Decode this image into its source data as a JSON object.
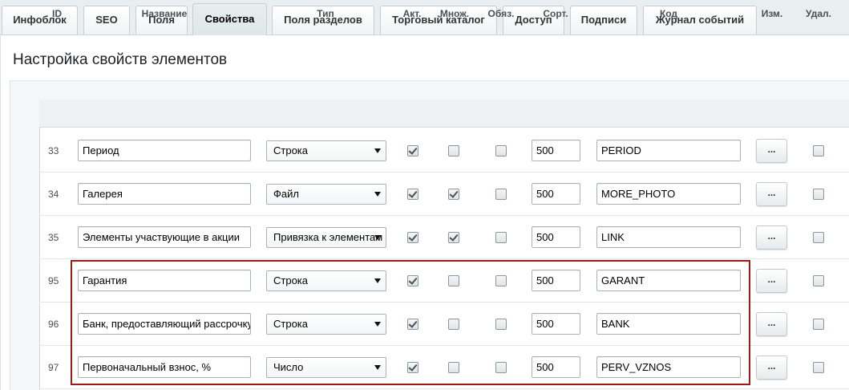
{
  "tabs": [
    {
      "label": "Инфоблок",
      "active": false
    },
    {
      "label": "SEO",
      "active": false
    },
    {
      "label": "Поля",
      "active": false
    },
    {
      "label": "Свойства",
      "active": true
    },
    {
      "label": "Поля разделов",
      "active": false
    },
    {
      "label": "Торговый каталог",
      "active": false
    },
    {
      "label": "Доступ",
      "active": false
    },
    {
      "label": "Подписи",
      "active": false
    },
    {
      "label": "Журнал событий",
      "active": false
    }
  ],
  "page_title": "Настройка свойств элементов",
  "columns": {
    "id": "ID",
    "name": "Название",
    "type": "Тип",
    "active": "Акт.",
    "multiple": "Множ.",
    "required": "Обяз.",
    "sort": "Сорт.",
    "code": "Код",
    "edit": "Изм.",
    "delete": "Удал."
  },
  "edit_button_label": "...",
  "rows": [
    {
      "id": "33",
      "name": "Период",
      "type": "Строка",
      "active": true,
      "multiple": false,
      "required": false,
      "sort": "500",
      "code": "PERIOD",
      "delete": false
    },
    {
      "id": "34",
      "name": "Галерея",
      "type": "Файл",
      "active": true,
      "multiple": true,
      "required": false,
      "sort": "500",
      "code": "MORE_PHOTO",
      "delete": false
    },
    {
      "id": "35",
      "name": "Элементы участвующие в акции",
      "type": "Привязка к элементам",
      "active": true,
      "multiple": true,
      "required": false,
      "sort": "500",
      "code": "LINK",
      "delete": false
    },
    {
      "id": "95",
      "name": "Гарантия",
      "type": "Строка",
      "active": true,
      "multiple": false,
      "required": false,
      "sort": "500",
      "code": "GARANT",
      "delete": false
    },
    {
      "id": "96",
      "name": "Банк, предоставляющий рассрочку",
      "type": "Строка",
      "active": true,
      "multiple": false,
      "required": false,
      "sort": "500",
      "code": "BANK",
      "delete": false
    },
    {
      "id": "97",
      "name": "Первоначальный взнос, %",
      "type": "Число",
      "active": true,
      "multiple": false,
      "required": false,
      "sort": "500",
      "code": "PERV_VZNOS",
      "delete": false
    }
  ],
  "colors": {
    "highlight_border": "#a01818",
    "tab_bar": "#e9eef0"
  }
}
